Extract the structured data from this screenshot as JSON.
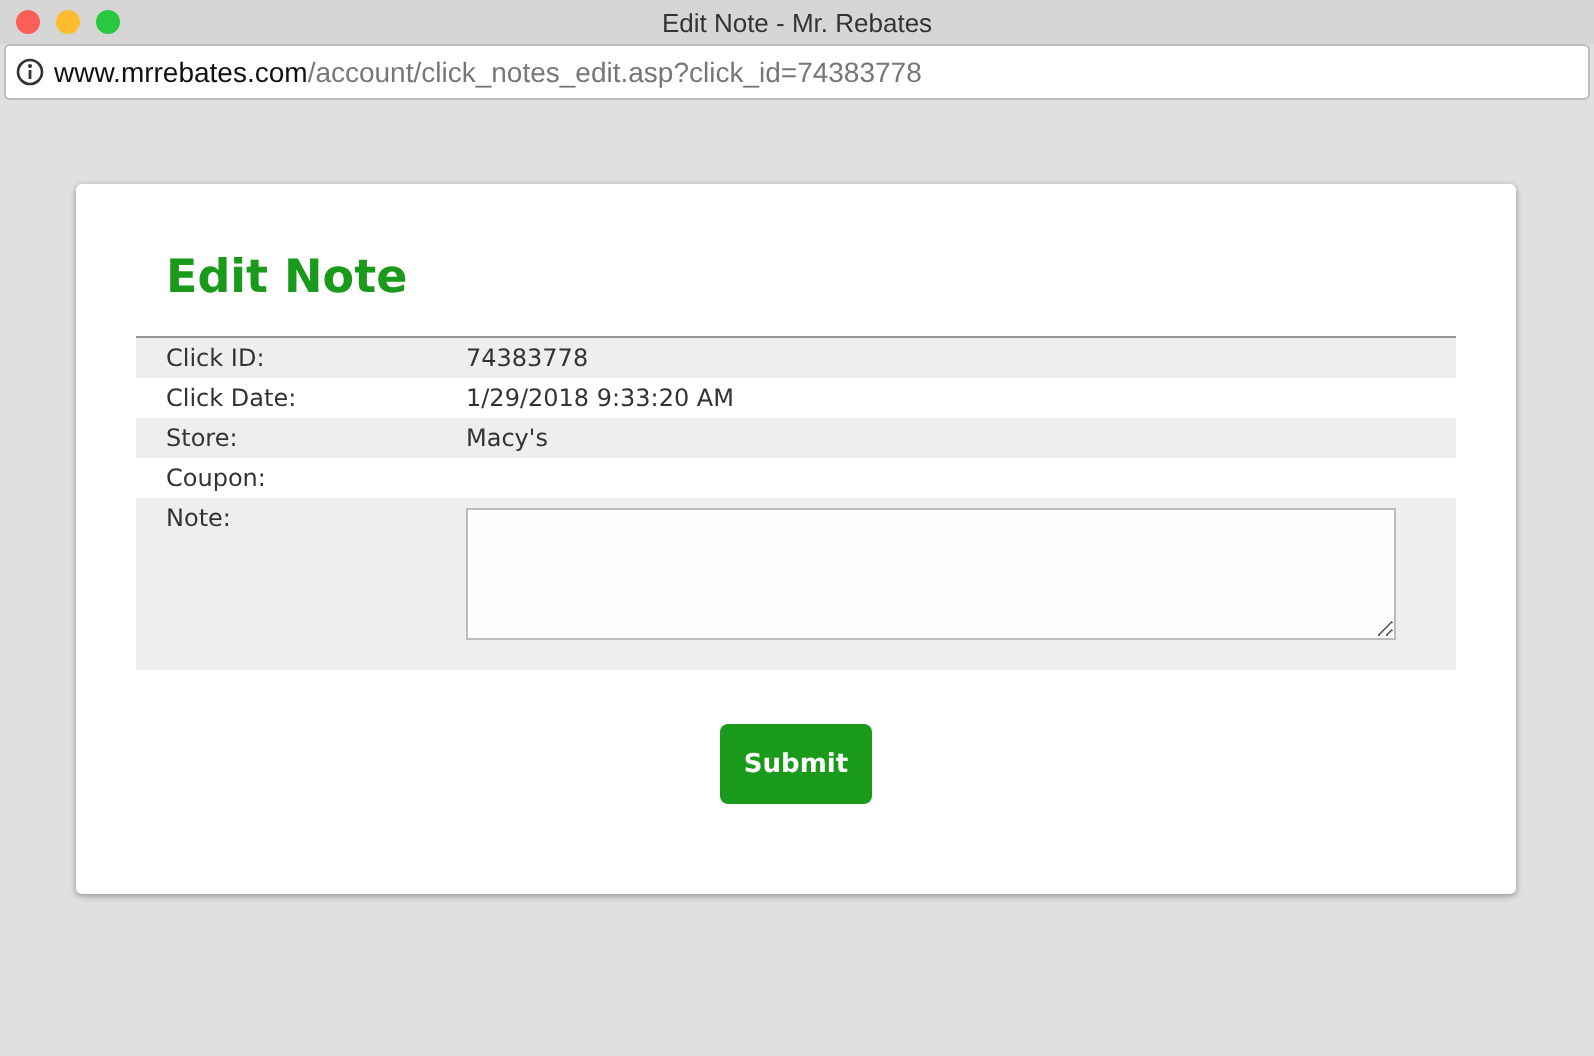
{
  "window": {
    "title": "Edit Note - Mr. Rebates"
  },
  "address_bar": {
    "domain": "www.mrrebates.com",
    "path": "/account/click_notes_edit.asp?click_id=74383778"
  },
  "page": {
    "heading": "Edit Note",
    "rows": [
      {
        "kind": "text",
        "label": "Click ID:",
        "value": "74383778"
      },
      {
        "kind": "text",
        "label": "Click Date:",
        "value": "1/29/2018 9:33:20 AM"
      },
      {
        "kind": "text",
        "label": "Store:",
        "value": "Macy's"
      },
      {
        "kind": "text",
        "label": "Coupon:"
      },
      {
        "kind": "textarea",
        "label": "Note:"
      }
    ],
    "button": "Submit"
  }
}
